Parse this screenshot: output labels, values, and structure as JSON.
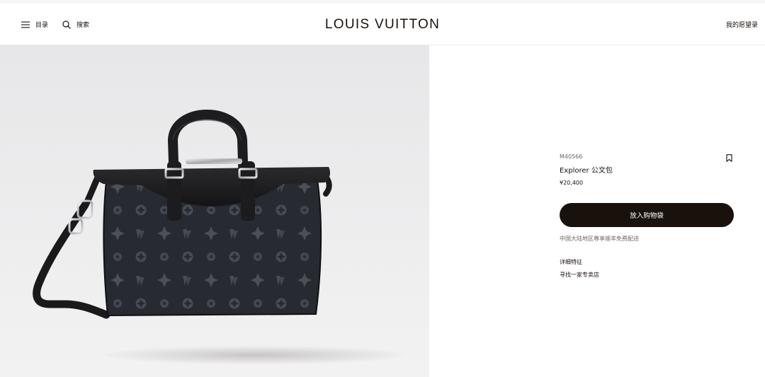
{
  "header": {
    "menu_icon": "hamburger-icon",
    "menu_label": "目录",
    "search_icon": "search-icon",
    "search_label": "搜索",
    "logo": "LOUIS VUITTON",
    "wishlist_label": "我的愿望录"
  },
  "product": {
    "sku": "M40566",
    "name": "Explorer 公文包",
    "price": "¥20,400",
    "bookmark_icon": "bookmark-icon",
    "add_to_cart_label": "放入购物袋",
    "delivery_note": "中国大陆地区尊享顺丰免费配送",
    "details_link": "详细特征",
    "store_link": "寻找一家专卖店"
  },
  "colors": {
    "brand_dark": "#19110b",
    "muted_text": "#6b6560",
    "hero_bg": "#ececed"
  }
}
